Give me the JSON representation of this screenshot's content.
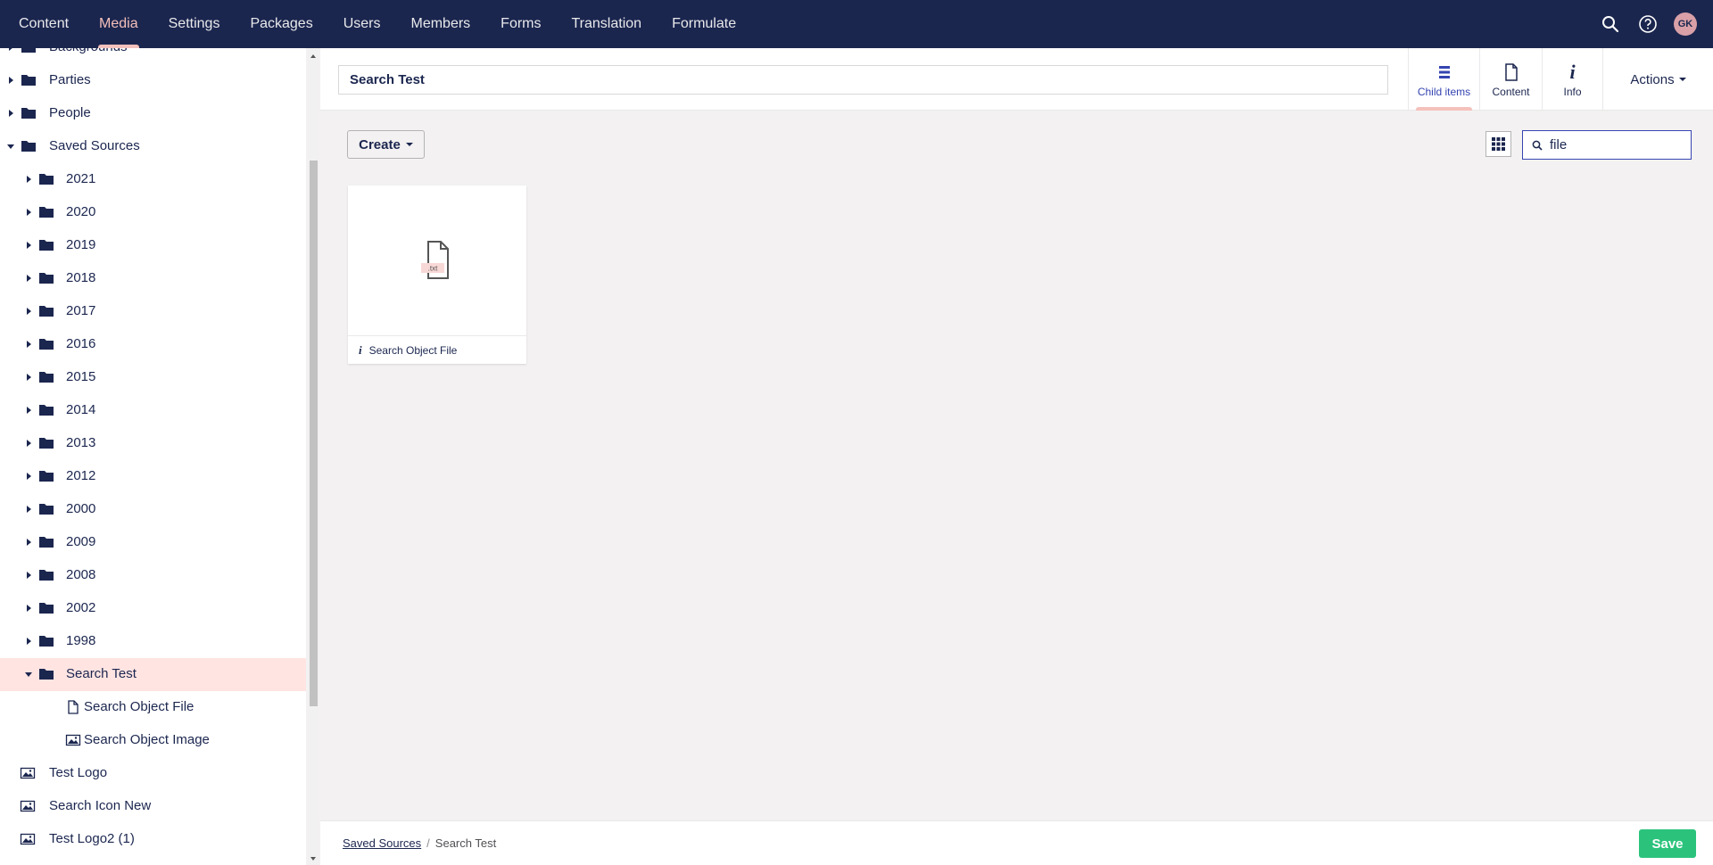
{
  "nav": {
    "items": [
      {
        "label": "Content"
      },
      {
        "label": "Media"
      },
      {
        "label": "Settings"
      },
      {
        "label": "Packages"
      },
      {
        "label": "Users"
      },
      {
        "label": "Members"
      },
      {
        "label": "Forms"
      },
      {
        "label": "Translation"
      },
      {
        "label": "Formulate"
      }
    ],
    "active": "Media",
    "user_initials": "GK"
  },
  "tree": {
    "items": [
      {
        "label": "Backgrounds",
        "icon": "folder-icon",
        "state": "collapsed"
      },
      {
        "label": "Parties",
        "icon": "folder-icon",
        "state": "collapsed"
      },
      {
        "label": "People",
        "icon": "folder-icon",
        "state": "collapsed"
      },
      {
        "label": "Saved Sources",
        "icon": "folder-icon",
        "state": "expanded"
      },
      {
        "label": "2021",
        "icon": "folder-icon",
        "state": "collapsed"
      },
      {
        "label": "2020",
        "icon": "folder-icon",
        "state": "collapsed"
      },
      {
        "label": "2019",
        "icon": "folder-icon",
        "state": "collapsed"
      },
      {
        "label": "2018",
        "icon": "folder-icon",
        "state": "collapsed"
      },
      {
        "label": "2017",
        "icon": "folder-icon",
        "state": "collapsed"
      },
      {
        "label": "2016",
        "icon": "folder-icon",
        "state": "collapsed"
      },
      {
        "label": "2015",
        "icon": "folder-icon",
        "state": "collapsed"
      },
      {
        "label": "2014",
        "icon": "folder-icon",
        "state": "collapsed"
      },
      {
        "label": "2013",
        "icon": "folder-icon",
        "state": "collapsed"
      },
      {
        "label": "2012",
        "icon": "folder-icon",
        "state": "collapsed"
      },
      {
        "label": "2000",
        "icon": "folder-icon",
        "state": "collapsed"
      },
      {
        "label": "2009",
        "icon": "folder-icon",
        "state": "collapsed"
      },
      {
        "label": "2008",
        "icon": "folder-icon",
        "state": "collapsed"
      },
      {
        "label": "2002",
        "icon": "folder-icon",
        "state": "collapsed"
      },
      {
        "label": "1998",
        "icon": "folder-icon",
        "state": "collapsed"
      },
      {
        "label": "Search Test",
        "icon": "folder-icon",
        "state": "expanded",
        "selected": true
      },
      {
        "label": "Search Object File",
        "icon": "file-icon"
      },
      {
        "label": "Search Object Image",
        "icon": "image-icon"
      },
      {
        "label": "Test Logo",
        "icon": "image-icon"
      },
      {
        "label": "Search Icon New",
        "icon": "image-icon"
      },
      {
        "label": "Test Logo2 (1)",
        "icon": "image-icon"
      }
    ]
  },
  "header": {
    "name": "Search Test",
    "tabs": [
      {
        "label": "Child items",
        "icon": "list-icon",
        "active": true
      },
      {
        "label": "Content",
        "icon": "document-icon"
      },
      {
        "label": "Info",
        "icon": "info-icon"
      }
    ],
    "actions_label": "Actions"
  },
  "toolbar": {
    "create_label": "Create",
    "search_value": "file"
  },
  "items": [
    {
      "name": "Search Object File",
      "file_ext": ".txt",
      "icon": "txt-file-icon"
    }
  ],
  "footer": {
    "breadcrumb": [
      {
        "label": "Saved Sources"
      },
      {
        "label": "Search Test"
      }
    ],
    "save_label": "Save"
  },
  "colors": {
    "nav_bg": "#1b264f",
    "accent_pink": "#f5c1bc",
    "selected_bg": "#ffe4e2",
    "save_green": "#2bc37c",
    "tab_active_blue": "#3544b1"
  }
}
